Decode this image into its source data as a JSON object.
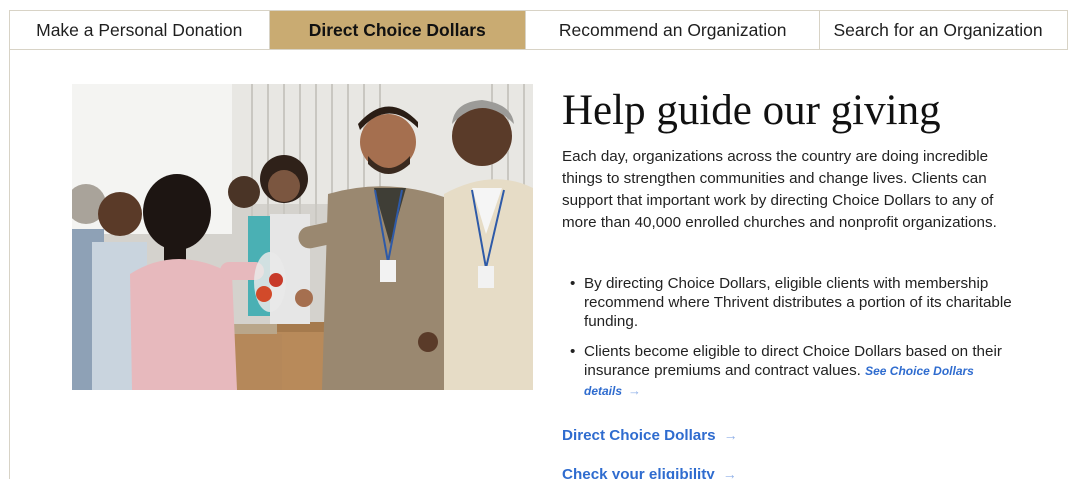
{
  "tabs": [
    {
      "label": "Make a Personal Donation",
      "active": false
    },
    {
      "label": "Direct Choice Dollars",
      "active": true
    },
    {
      "label": "Recommend an Organization",
      "active": false
    },
    {
      "label": "Search for an Organization",
      "active": false
    }
  ],
  "hero": {
    "headline": "Help guide our giving",
    "intro": "Each day, organizations across the country are doing incredible things to strengthen communities and change lives. Clients can support that important work by directing Choice Dollars to any of more than 40,000 enrolled churches and nonprofit organizations.",
    "bullets": [
      {
        "text": "By directing Choice Dollars, eligible clients with membership recommend where Thrivent distributes a portion of its charitable funding.",
        "link": ""
      },
      {
        "text": "Clients become eligible to direct Choice Dollars based on their insurance premiums and contract values.",
        "link": "See Choice Dollars details"
      }
    ],
    "links": [
      {
        "label": "Direct Choice Dollars"
      },
      {
        "label": "Check your eligibility"
      }
    ]
  },
  "icons": {
    "arrow": "→",
    "bullet": "•"
  },
  "colors": {
    "active_tab": "#c9ab72",
    "link": "#2f6ccf",
    "border": "#d8d3c6"
  }
}
